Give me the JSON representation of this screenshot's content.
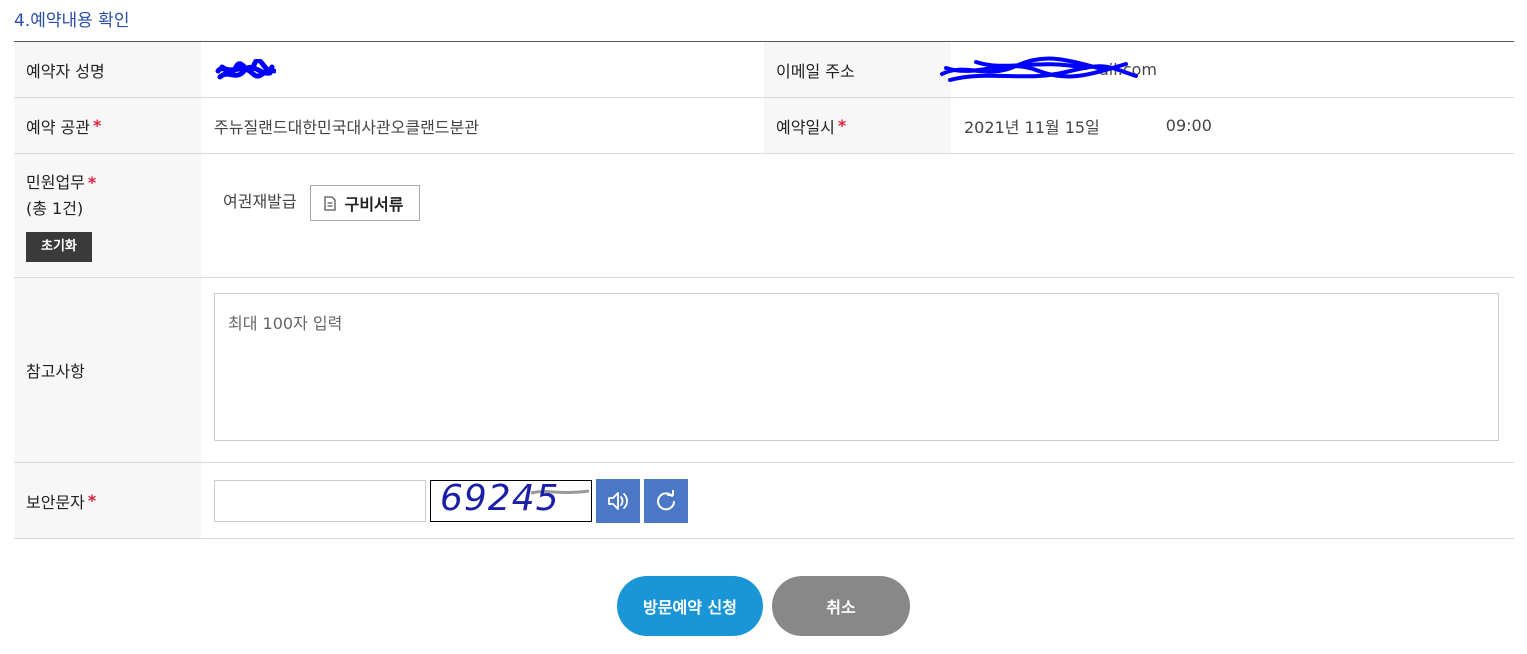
{
  "section_title": "4.예약내용 확인",
  "labels": {
    "name": "예약자 성명",
    "email": "이메일 주소",
    "office": "예약 공관",
    "datetime": "예약일시",
    "task": "민원업무",
    "task_count": "(총 1건)",
    "memo": "참고사항",
    "captcha": "보안문자"
  },
  "required_mark": "*",
  "values": {
    "email_visible": "ail.com",
    "office": "주뉴질랜드대한민국대사관오클랜드분관",
    "date": "2021년 11월 15일",
    "time": "09:00",
    "task_item": "여권재발급"
  },
  "buttons": {
    "reset": "초기화",
    "documents": "구비서류",
    "submit": "방문예약 신청",
    "cancel": "취소"
  },
  "memo": {
    "placeholder": "최대 100자 입력",
    "value": ""
  },
  "captcha": {
    "input_value": "",
    "image_text": "69245"
  },
  "icons": {
    "documents": "document-icon",
    "audio": "speaker-icon",
    "refresh": "refresh-icon"
  },
  "colors": {
    "title": "#2b4ea8",
    "required": "#e2203a",
    "submit": "#1a96d6",
    "cancel": "#888888",
    "icon_button": "#4a78c7",
    "redaction": "#0000ff"
  }
}
